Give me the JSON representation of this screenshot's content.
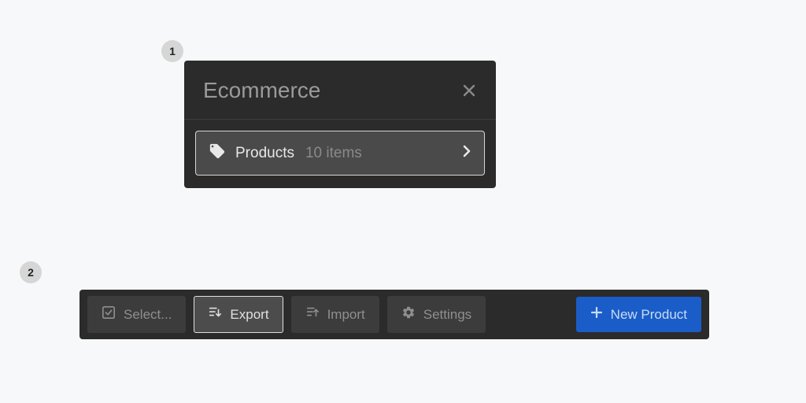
{
  "steps": {
    "one": "1",
    "two": "2"
  },
  "panel": {
    "title": "Ecommerce",
    "collection": {
      "label": "Products",
      "count": "10 items"
    }
  },
  "toolbar": {
    "select": "Select...",
    "export": "Export",
    "import": "Import",
    "settings": "Settings",
    "new_product": "New Product"
  }
}
